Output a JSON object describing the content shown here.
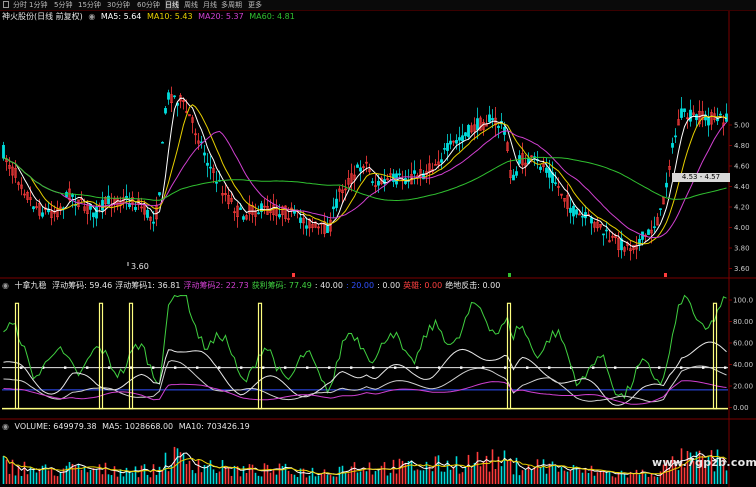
{
  "toolbar": {
    "items": [
      {
        "label": "分时",
        "x": 13
      },
      {
        "label": "1分钟",
        "x": 29
      },
      {
        "label": "5分钟",
        "x": 54
      },
      {
        "label": "15分钟",
        "x": 78
      },
      {
        "label": "30分钟",
        "x": 107
      },
      {
        "label": "60分钟",
        "x": 137
      },
      {
        "label": "日线",
        "x": 165,
        "selected": true
      },
      {
        "label": "周线",
        "x": 184
      },
      {
        "label": "月线",
        "x": 203
      },
      {
        "label": "多周期",
        "x": 221
      },
      {
        "label": "更多",
        "x": 248
      }
    ]
  },
  "price_panel": {
    "stock_name": "神火股份(日线 前复权)",
    "ma5_label": "MA5: 5.64",
    "ma10_label": "MA10: 5.43",
    "ma20_label": "MA20: 5.37",
    "ma60_label": "MA60: 4.81",
    "low_label": "3.60",
    "price_box": "4.53 - 4.57",
    "y_ticks": [
      "5.00",
      "4.80",
      "4.60",
      "4.40",
      "4.20",
      "4.00",
      "3.80",
      "3.60"
    ],
    "y_range": [
      3.55,
      5.1
    ]
  },
  "indicator_panel": {
    "title": "十拿九稳",
    "labels": [
      {
        "text": "浮动筹码: 59.46",
        "color": "#e6e6e6"
      },
      {
        "text": "浮动筹码1: 36.81",
        "color": "#e6e6e6"
      },
      {
        "text": "浮动筹码2: 22.73",
        "color": "#d040d0"
      },
      {
        "text": "获利筹码: 77.49",
        "color": "#40d040"
      },
      {
        "text": ": 40.00",
        "color": "#e6e6e6"
      },
      {
        "text": ": 20.00",
        "color": "#3050ff"
      },
      {
        "text": ": 0.00",
        "color": "#e6e6e6"
      },
      {
        "text": "英雄: 0.00",
        "color": "#ff4040"
      },
      {
        "text": "绝地反击: 0.00",
        "color": "#e6e6e6"
      }
    ],
    "y_ticks": [
      "100.0",
      "80.00",
      "60.00",
      "40.00",
      "20.00",
      "0.00"
    ]
  },
  "volume_panel": {
    "volume_label": "VOLUME: 649979.38",
    "ma5_label": "MA5: 1028668.00",
    "ma10_label": "MA10: 703426.19"
  },
  "colors": {
    "up": "#ff3c3c",
    "down": "#00dcdc",
    "ma5": "#ffffff",
    "ma10": "#e8d000",
    "ma20": "#d040d0",
    "ma60": "#30c030",
    "green_line": "#40d040",
    "yellow": "#ffff80",
    "blue": "#3050ff"
  },
  "watermark": "www.7gpzb.com"
}
